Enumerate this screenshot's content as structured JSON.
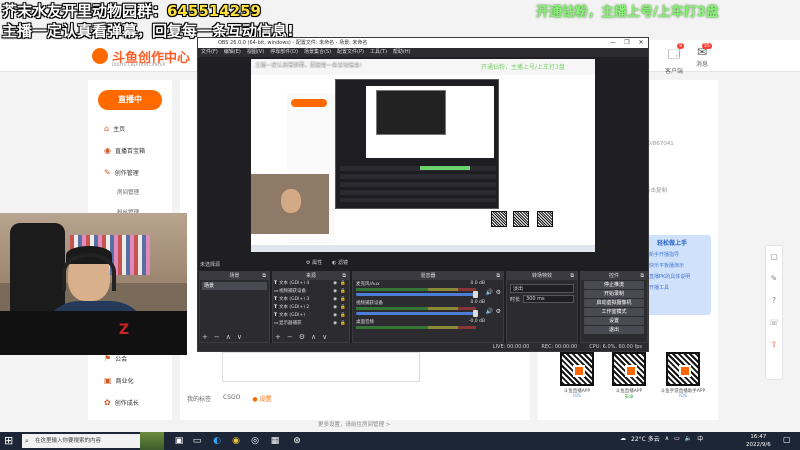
{
  "stream_overlay": {
    "line1_prefix": "芥末水友开里动物园群：",
    "line1_number": "645514259",
    "line2": "主播一定认真看弹幕，回复每一条互动信息!",
    "top_right": "开通钻粉，主播上号/上车打3盘"
  },
  "web": {
    "logo_text": "斗鱼创作中心",
    "logo_sub": "DOUYU CREATION CENTER",
    "top_icons": [
      {
        "label": "客户端",
        "icon": "client-icon",
        "badge": "9"
      },
      {
        "label": "消息",
        "icon": "message-icon",
        "badge": "35"
      }
    ],
    "live_button": "直播中",
    "nav": [
      {
        "label": "主页",
        "icon": "home-icon"
      },
      {
        "label": "直播百宝箱",
        "icon": "toolbox-icon"
      },
      {
        "label": "创作管理",
        "icon": "creation-icon"
      }
    ],
    "nav_subs": [
      "房间管理",
      "粉丝管理"
    ],
    "nav_bottom": [
      {
        "label": "公会",
        "icon": "guild-icon"
      },
      {
        "label": "商业化",
        "icon": "business-icon"
      },
      {
        "label": "创作成长",
        "icon": "growth-icon"
      }
    ],
    "id_text": "ID/867041",
    "gray_text": "点击复制",
    "promo": {
      "header": "轻松做上手",
      "lines": [
        "新手开播指导",
        "快乐平板播演示",
        "直播PK的具体说明",
        "开播工具"
      ]
    },
    "qr_cards": [
      {
        "caption": "斗鱼直播APP",
        "sub": "iOS",
        "color": "#4a90e2"
      },
      {
        "caption": "斗鱼直播APP",
        "sub": "安卓",
        "color": "#3cb44b"
      },
      {
        "caption": "斗鱼手游直播助手APP",
        "sub": "iOS",
        "color": "#4a90e2"
      }
    ],
    "tags_label": "我的标签",
    "tags": [
      "CSGO",
      "设置"
    ],
    "footer_note": "更多设置，请前往房间管理 >",
    "rail_icons": [
      "app-icon",
      "feedback-icon",
      "help-icon",
      "support-icon",
      "top-icon"
    ]
  },
  "obs": {
    "title": "OBS 26.0.0 (64-bit, windows) - 配置文件: 未命名 - 场景: 未命名",
    "window_buttons": [
      "—",
      "❐",
      "✕"
    ],
    "menu": [
      "文件(F)",
      "编辑(E)",
      "视图(V)",
      "停靠部件(D)",
      "场景集合(S)",
      "配置文件(P)",
      "工具(T)",
      "帮助(H)"
    ],
    "preview": {
      "overlay_white": "主播一定认真看弹幕，回复每一条互动信息!",
      "overlay_green": "开通钻粉，主播上号/上车打3盘"
    },
    "current_scene": "未选择源",
    "props_buttons": [
      "属性",
      "滤镜"
    ],
    "docks": {
      "scenes": {
        "title": "场景",
        "items": [
          "场景"
        ]
      },
      "sources": {
        "title": "来源",
        "items": [
          "文本 (GDI+) 4",
          "视频捕获设备",
          "文本 (GDI+) 3",
          "文本 (GDI+) 2",
          "文本 (GDI+)",
          "显示器捕获"
        ]
      },
      "mixer": {
        "title": "混音器",
        "channels": [
          {
            "name": "麦克风/Aux",
            "db": "0.0 dB"
          },
          {
            "name": "视频捕获设备",
            "db": "0.0 dB"
          },
          {
            "name": "桌面音频",
            "db": "-0.0 dB"
          }
        ]
      },
      "transitions": {
        "title": "转场特效",
        "selected": "淡出",
        "duration_label": "时长",
        "duration_value": "300 ms"
      },
      "controls": {
        "title": "控件",
        "buttons": [
          "停止推流",
          "开始录制",
          "启动虚拟摄像机",
          "工作室模式",
          "设置",
          "退出"
        ]
      }
    },
    "status": {
      "live": "LIVE: 00:00:00",
      "rec": "REC: 00:00:00",
      "cpu": "CPU: 6.0%, 60.00 fps"
    }
  },
  "taskbar": {
    "search_placeholder": "在这里输入你要搜索的内容",
    "apps": [
      "task-view-icon",
      "file-explorer-icon",
      "edge-icon",
      "chrome-icon",
      "obs-icon",
      "app-icon",
      "steam-icon"
    ],
    "weather": "22°C 多云",
    "ime": "中",
    "time": "16:47",
    "date": "2022/9/6"
  }
}
